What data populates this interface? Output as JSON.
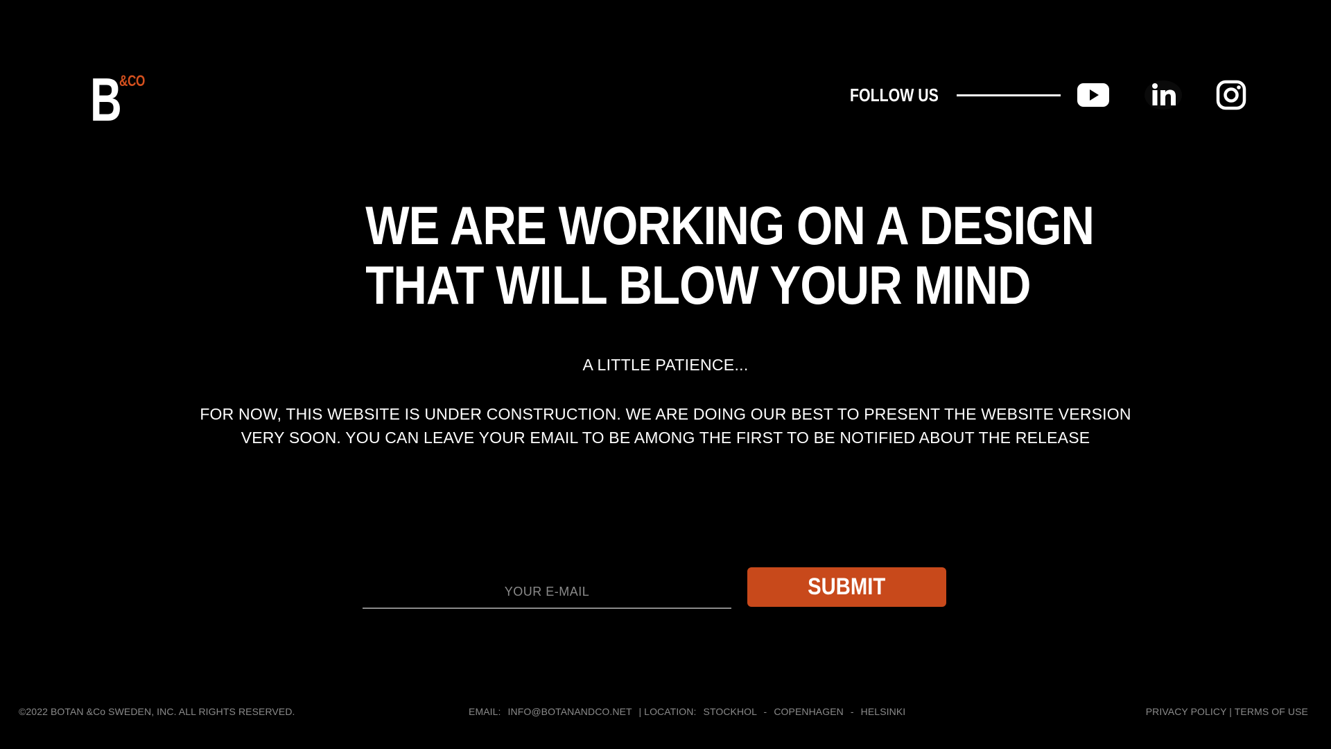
{
  "logo": {
    "letter": "B",
    "suffix": "&CO"
  },
  "header": {
    "follow_label": "FOLLOW US",
    "social": [
      {
        "name": "youtube-icon"
      },
      {
        "name": "linkedin-icon"
      },
      {
        "name": "instagram-icon"
      }
    ]
  },
  "hero": {
    "headline_line1": "WE ARE WORKING ON A DESIGN",
    "headline_line2": "THAT WILL BLOW YOUR MIND",
    "subtitle": "A LITTLE PATIENCE...",
    "description": "FOR NOW, THIS WEBSITE IS UNDER CONSTRUCTION. WE ARE DOING OUR BEST TO PRESENT THE WEBSITE VERSION VERY SOON. YOU CAN LEAVE YOUR EMAIL TO BE AMONG THE FIRST TO BE NOTIFIED ABOUT THE RELEASE"
  },
  "form": {
    "email_placeholder": "YOUR E-MAIL",
    "email_value": "",
    "submit_label": "SUBMIT"
  },
  "footer": {
    "copyright": "©2022 BOTAN &Co SWEDEN, INC. ALL RIGHTS RESERVED.",
    "email_label": "EMAIL:",
    "email_value": "INFO@BOTANANDCO.NET",
    "location_label": "| LOCATION:",
    "location_1": "STOCKHOL",
    "location_2": "COPENHAGEN",
    "location_3": "HELSINKI",
    "location_sep": "-",
    "privacy_link": "PRIVACY POLICY",
    "links_sep": "|",
    "terms_link": "TERMS OF USE"
  },
  "colors": {
    "background": "#000000",
    "accent": "#c8491b",
    "text": "#ffffff",
    "muted": "#8a8a8a"
  }
}
